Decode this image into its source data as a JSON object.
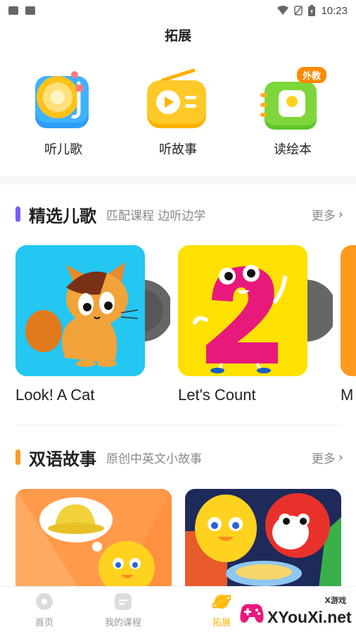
{
  "status_bar": {
    "time": "10:23"
  },
  "header": {
    "title": "拓展"
  },
  "quick_actions": [
    {
      "label": "听儿歌",
      "icon": "record-player-icon"
    },
    {
      "label": "听故事",
      "icon": "radio-icon"
    },
    {
      "label": "读绘本",
      "icon": "picture-book-icon",
      "badge": "外教"
    }
  ],
  "songs_section": {
    "title": "精选儿歌",
    "subtitle": "匹配课程 边听边学",
    "more": "更多",
    "accent": "#7b5cff",
    "items": [
      {
        "title": "Look! A Cat"
      },
      {
        "title": "Let's Count"
      },
      {
        "title": "M"
      }
    ]
  },
  "stories_section": {
    "title": "双语故事",
    "subtitle": "原创中英文小故事",
    "more": "更多",
    "accent": "#ff9a1f"
  },
  "tab_bar": {
    "tabs": [
      {
        "label": "首页",
        "icon": "home-icon",
        "active": false
      },
      {
        "label": "我的课程",
        "icon": "courses-icon",
        "active": false
      },
      {
        "label": "拓展",
        "icon": "explore-icon",
        "active": true
      }
    ]
  },
  "watermark": {
    "small": "X游戏",
    "text": "XYouXi.net"
  },
  "colors": {
    "badge": "#ff8a00",
    "active_tab": "#ffb300",
    "song_bg_1": "#24c6f2",
    "song_bg_2": "#ffe100"
  }
}
